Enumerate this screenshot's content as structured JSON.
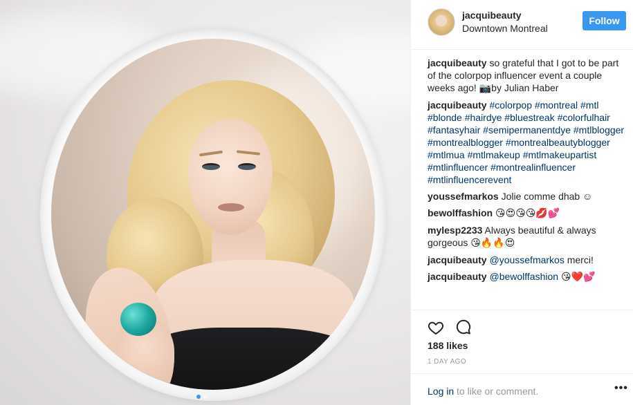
{
  "post": {
    "username": "jacquibeauty",
    "location": "Downtown Montreal",
    "follow_label": "Follow"
  },
  "carousel": {
    "current": 1,
    "total": 2
  },
  "caption": {
    "user": "jacquibeauty",
    "text_before": "so grateful that I got to be part of the colorpop influencer event a couple weeks ago! ",
    "camera_emoji": "📷",
    "text_after": "by Julian Haber"
  },
  "hashtags": {
    "user": "jacquibeauty",
    "text": "#colorpop #montreal #mtl #blonde #hairdye #bluestreak #colorfulhair #fantasyhair #semipermanentdye #mtlblogger #montrealblogger #montrealbeautyblogger #mtlmua #mtlmakeup #mtlmakeupartist #mtlinfluencer #montrealinfluencer #mtlinfluencerevent"
  },
  "comments": [
    {
      "user": "youssefmarkos",
      "text": "Jolie comme dhab ☺",
      "mention": "",
      "emoji": ""
    },
    {
      "user": "bewolffashion",
      "text": "",
      "mention": "",
      "emoji": "😘😍😘😘💋💕"
    },
    {
      "user": "mylesp2233",
      "text": "Always beautiful & always gorgeous ",
      "mention": "",
      "emoji": "😘🔥🔥😍"
    },
    {
      "user": "jacquibeauty",
      "text": " merci!",
      "mention": "@youssefmarkos",
      "emoji": ""
    },
    {
      "user": "jacquibeauty",
      "text": " ",
      "mention": "@bewolffashion",
      "emoji": "😘❤️💕"
    }
  ],
  "stats": {
    "likes": "188 likes",
    "time": "1 DAY AGO"
  },
  "footer": {
    "login_link": "Log in",
    "login_rest": " to like or comment.",
    "more": "•••"
  },
  "colors": {
    "accent": "#3897f0",
    "hashtag": "#003569",
    "muted": "#999999"
  },
  "icons": [
    "heart-icon",
    "comment-icon",
    "more-options-icon"
  ]
}
